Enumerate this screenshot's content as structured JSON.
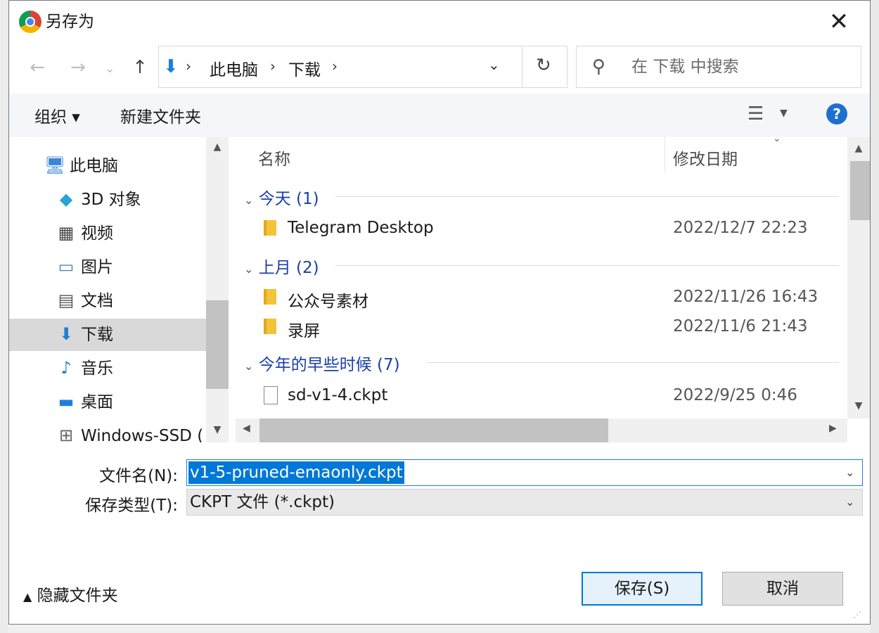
{
  "window": {
    "title": "另存为",
    "close_icon": "✕"
  },
  "nav": {
    "back_icon": "←",
    "forward_icon": "→",
    "recent_icon": "⌄",
    "up_icon": "↑",
    "breadcrumb": [
      "此电脑",
      "下载"
    ],
    "refresh_icon": "↻",
    "search_placeholder": "在 下载 中搜索"
  },
  "toolbar": {
    "organize": "组织 ▾",
    "new_folder": "新建文件夹",
    "help": "?"
  },
  "sidebar": {
    "items": [
      {
        "label": "此电脑",
        "icon": "computer-icon"
      },
      {
        "label": "3D 对象",
        "icon": "cube-icon"
      },
      {
        "label": "视频",
        "icon": "video-icon"
      },
      {
        "label": "图片",
        "icon": "picture-icon"
      },
      {
        "label": "文档",
        "icon": "document-icon"
      },
      {
        "label": "下载",
        "icon": "download-icon",
        "selected": true
      },
      {
        "label": "音乐",
        "icon": "music-icon"
      },
      {
        "label": "桌面",
        "icon": "desktop-icon"
      },
      {
        "label": "Windows-SSD (",
        "icon": "drive-icon"
      }
    ]
  },
  "filelist": {
    "columns": {
      "name": "名称",
      "date": "修改日期"
    },
    "groups": [
      {
        "title": "今天 (1)",
        "items": [
          {
            "name": "Telegram Desktop",
            "date": "2022/12/7 22:23",
            "type": "folder"
          }
        ]
      },
      {
        "title": "上月 (2)",
        "items": [
          {
            "name": "公众号素材",
            "date": "2022/11/26 16:43",
            "type": "folder"
          },
          {
            "name": "录屏",
            "date": "2022/11/6 21:43",
            "type": "folder"
          }
        ]
      },
      {
        "title": "今年的早些时候 (7)",
        "items": [
          {
            "name": "sd-v1-4.ckpt",
            "date": "2022/9/25 0:46",
            "type": "file"
          }
        ]
      }
    ]
  },
  "form": {
    "filename_label": "文件名(N):",
    "filename_value": "v1-5-pruned-emaonly.ckpt",
    "filetype_label": "保存类型(T):",
    "filetype_value": "CKPT 文件 (*.ckpt)"
  },
  "footer": {
    "hide_folders": "隐藏文件夹",
    "save": "保存(S)",
    "cancel": "取消"
  },
  "colors": {
    "accent": "#0078d7",
    "group_header": "#1a3fa8",
    "selected_bg": "#d9d9d9"
  }
}
